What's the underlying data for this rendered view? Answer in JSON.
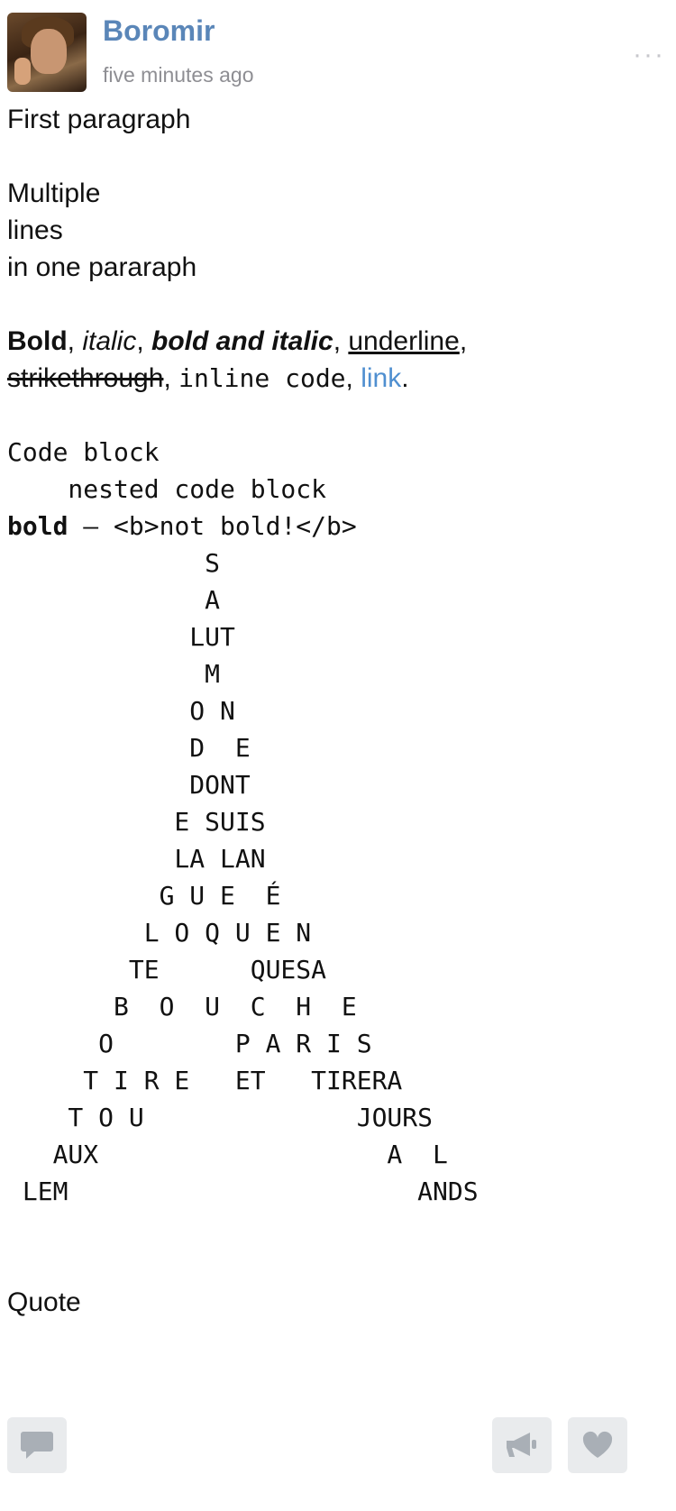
{
  "post": {
    "author": "Boromir",
    "time": "five minutes ago",
    "more_label": "···"
  },
  "body": {
    "para1": "First paragraph",
    "para2": "Multiple\nlines\nin one pararaph",
    "fmt": {
      "bold": "Bold",
      "sep1": ", ",
      "italic": "italic",
      "sep2": ", ",
      "bold_italic": "bold and italic",
      "sep3": ", ",
      "underline": "underline",
      "sep4": ",",
      "strike": "strikethrough",
      "sep5": ", ",
      "inline_code": "inline code",
      "sep6": ", ",
      "link": "link",
      "end": "."
    },
    "code_line1": "Code block",
    "code_line2": "    nested code block",
    "code_bold": "bold",
    "code_rest": " — <b>not bold!</b>",
    "tree": "             S\n             A\n            LUT\n             M\n            O N\n            D  E\n            DONT\n           E SUIS\n           LA LAN\n          G U E  É\n         L O Q U E N\n        TE      QUESA\n       B  O  U  C  H  E\n      O        P A R I S\n     T I R E   ET   TIRERA\n    T O U              JOURS\n   AUX                   A  L\n LEM                       ANDS",
    "quote": "Quote"
  },
  "footer": {
    "reply_icon": "comment-icon",
    "share_icon": "megaphone-icon",
    "like_icon": "heart-icon"
  }
}
